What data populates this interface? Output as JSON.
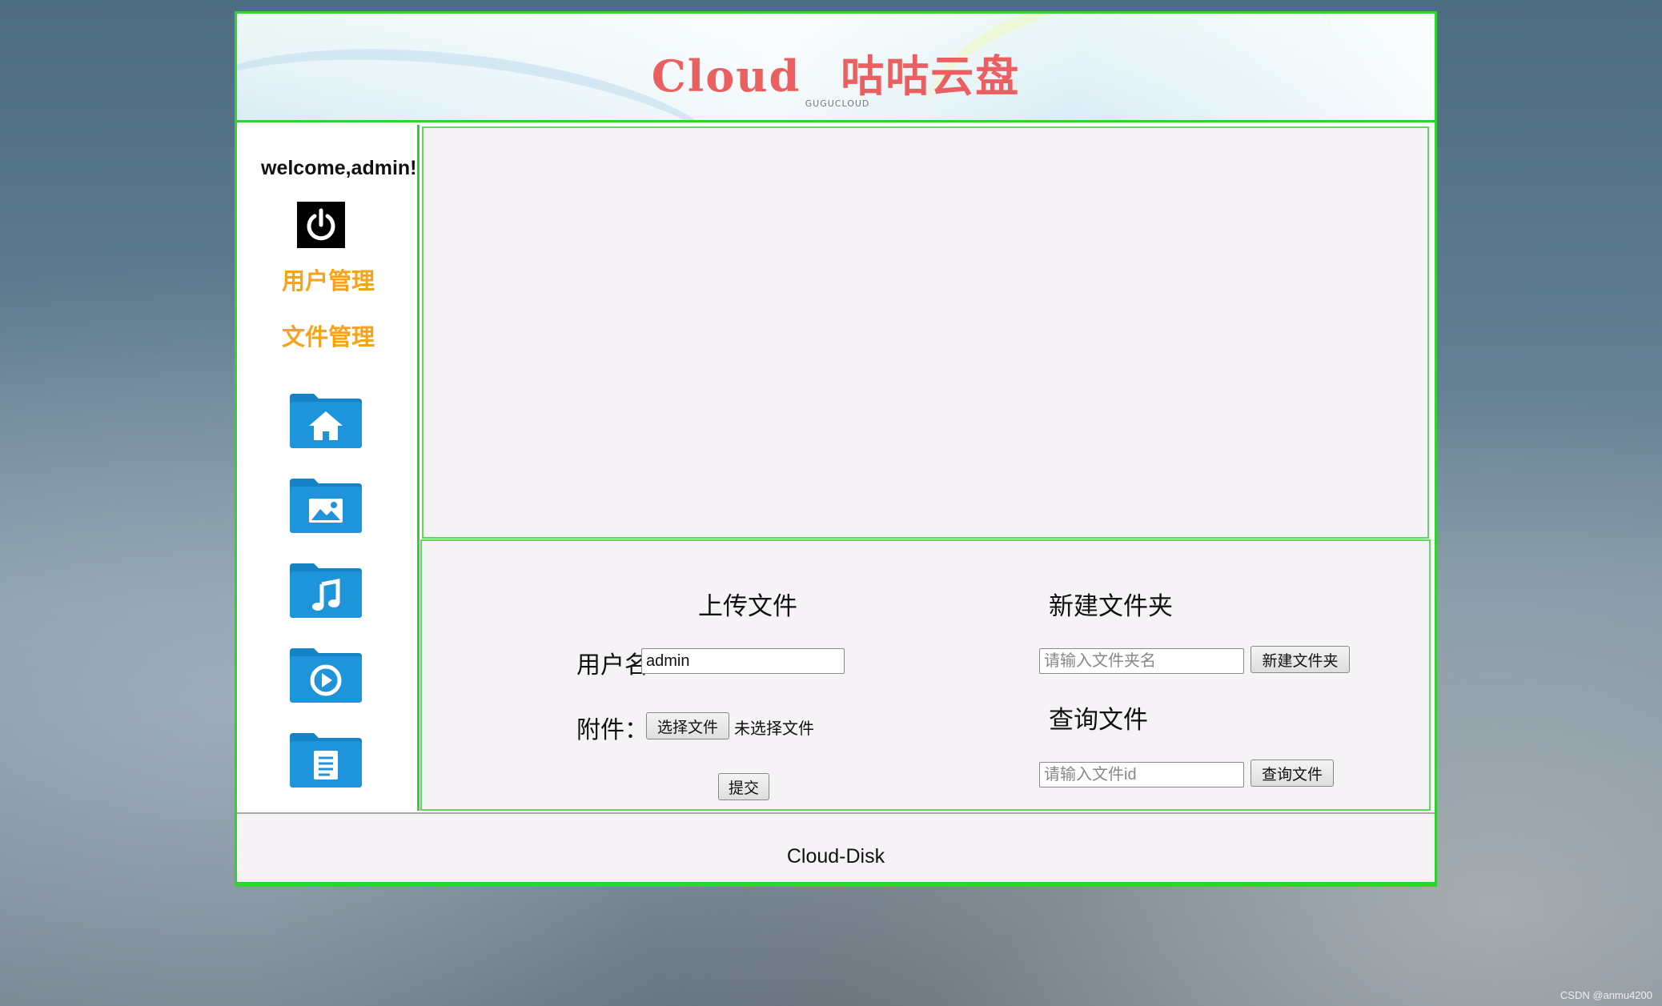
{
  "banner": {
    "title_en": "Cloud",
    "title_cn": "咕咕云盘",
    "subtitle": "GUGUCLOUD"
  },
  "sidebar": {
    "welcome": "welcome,admin!",
    "logout_icon": "power-icon",
    "links": [
      "用户管理",
      "文件管理"
    ],
    "folders": [
      "home-folder-icon",
      "image-folder-icon",
      "music-folder-icon",
      "video-folder-icon",
      "document-folder-icon"
    ]
  },
  "upload": {
    "heading": "上传文件",
    "username_label": "用户名:",
    "username_value": "admin",
    "attachment_label": "附件：",
    "choose_button": "选择文件",
    "no_file_text": "未选择文件",
    "submit_button": "提交"
  },
  "new_folder": {
    "heading": "新建文件夹",
    "placeholder": "请输入文件夹名",
    "button": "新建文件夹"
  },
  "query": {
    "heading": "查询文件",
    "placeholder": "请输入文件id",
    "button": "查询文件"
  },
  "footer": {
    "text": "Cloud-Disk"
  },
  "watermark": "CSDN @anmu4200",
  "colors": {
    "border_green": "#2bd52b",
    "nav_orange": "#f7a21b",
    "title_red": "#ea6060",
    "folder_blue": "#1e8fd5"
  }
}
